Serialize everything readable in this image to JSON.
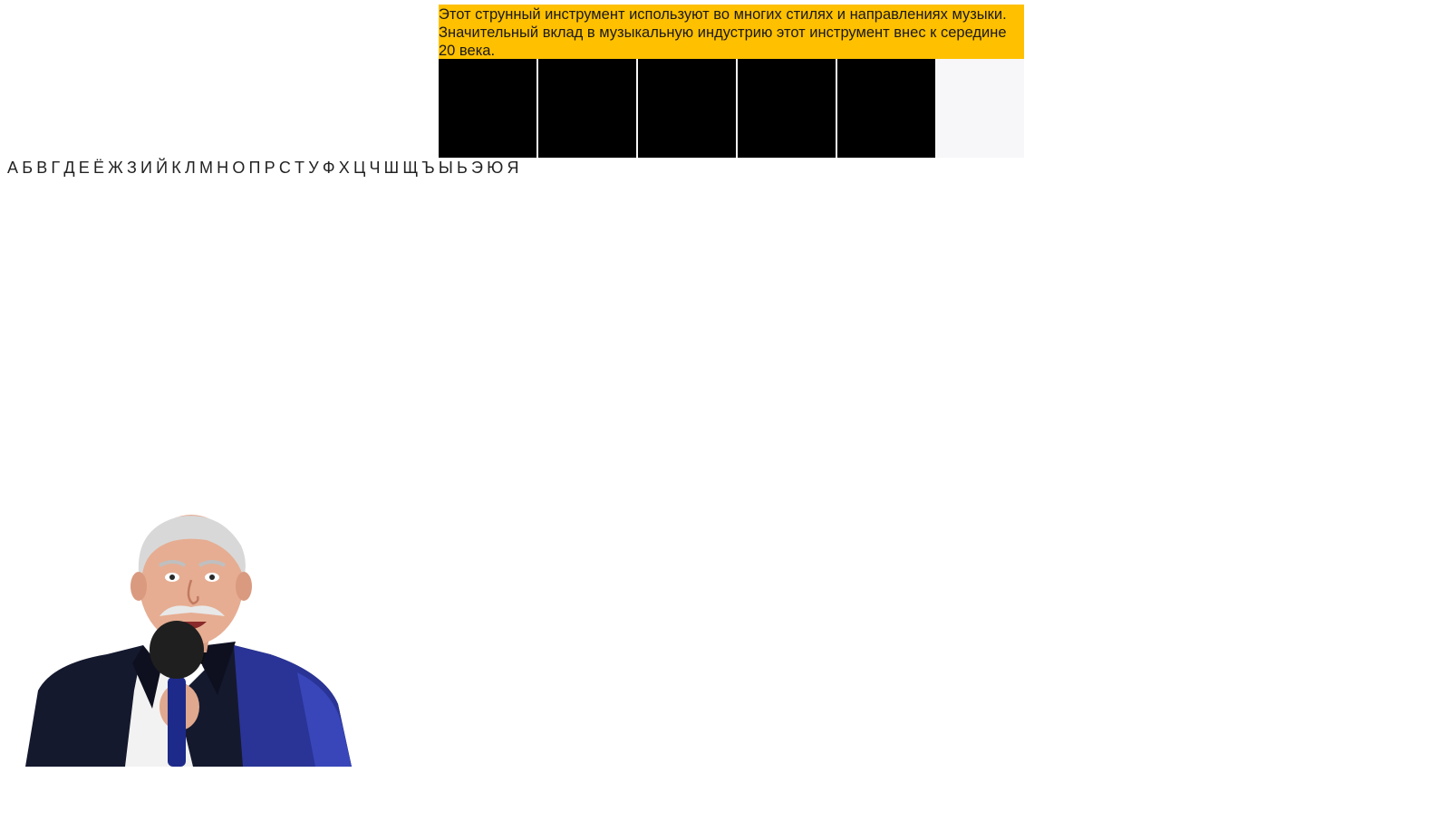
{
  "clue": {
    "text": "Этот струнный инструмент используют во многих стилях и направлениях музыки. Значительный вклад в музыкальную индустрию этот инструмент внес к середине 20 века.",
    "background": "#ffc000"
  },
  "board": {
    "cells": [
      {
        "letter": "",
        "state": "hidden"
      },
      {
        "letter": "",
        "state": "hidden"
      },
      {
        "letter": "",
        "state": "hidden"
      },
      {
        "letter": "",
        "state": "hidden"
      },
      {
        "letter": "",
        "state": "hidden"
      }
    ],
    "hidden_color": "#000000"
  },
  "alphabet": [
    "А",
    "Б",
    "В",
    "Г",
    "Д",
    "Е",
    "Ё",
    "Ж",
    "З",
    "И",
    "Й",
    "К",
    "Л",
    "М",
    "Н",
    "О",
    "П",
    "Р",
    "С",
    "Т",
    "У",
    "Ф",
    "Х",
    "Ц",
    "Ч",
    "Ш",
    "Щ",
    "Ъ",
    "Ы",
    "Ь",
    "Э",
    "Ю",
    "Я"
  ],
  "host": {
    "icon": "host-with-microphone-image"
  }
}
